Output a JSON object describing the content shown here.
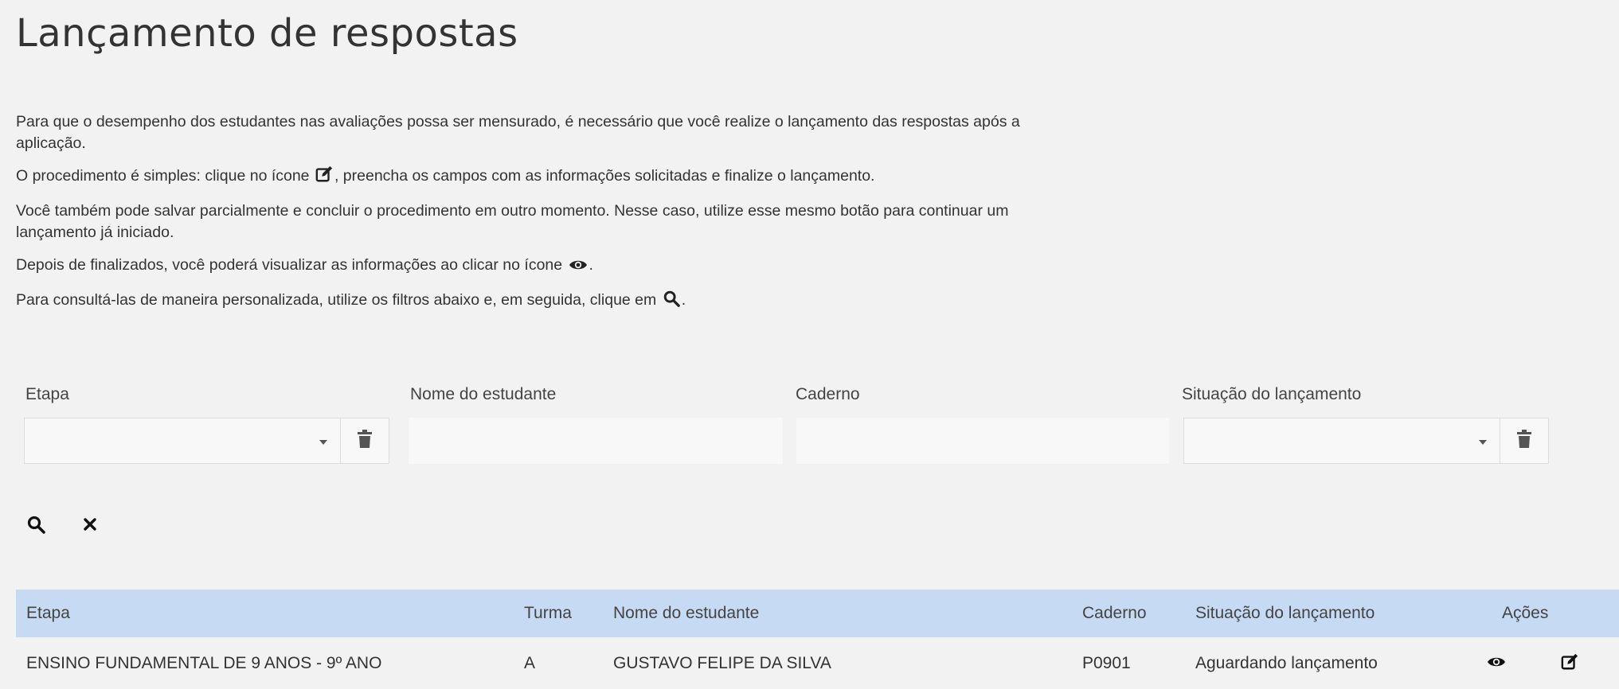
{
  "page": {
    "title": "Lançamento de respostas"
  },
  "intro": {
    "p1": "Para que o desempenho dos estudantes nas avaliações possa ser mensurado, é necessário que você realize o lançamento das respostas após a aplicação.",
    "p2_before": "O procedimento é simples: clique no ícone ",
    "p2_after": ", preencha os campos com as informações solicitadas e finalize o lançamento.",
    "p3": "Você também pode salvar parcialmente e concluir o procedimento em outro momento. Nesse caso, utilize esse mesmo botão para continuar um lançamento já iniciado.",
    "p4_before": "Depois de finalizados, você poderá visualizar as informações ao clicar no ícone ",
    "p4_after": ".",
    "p5_before": "Para consultá-las de maneira personalizada, utilize os filtros abaixo e, em seguida, clique em ",
    "p5_after": "."
  },
  "filters": {
    "etapa": {
      "label": "Etapa",
      "value": ""
    },
    "nome": {
      "label": "Nome do estudante",
      "value": "",
      "placeholder": ""
    },
    "caderno": {
      "label": "Caderno",
      "value": "",
      "placeholder": ""
    },
    "situacao": {
      "label": "Situação do lançamento",
      "value": ""
    }
  },
  "icons": {
    "edit": "edit-icon",
    "view": "eye-icon",
    "search": "search-icon",
    "clear": "close-icon",
    "trash": "trash-icon",
    "caret": "chevron-down-icon"
  },
  "colors": {
    "table_header_bg": "#c6daf3",
    "page_bg": "#f2f2f2"
  },
  "table": {
    "headers": {
      "etapa": "Etapa",
      "turma": "Turma",
      "nome": "Nome do estudante",
      "caderno": "Caderno",
      "situacao": "Situação do lançamento",
      "acoes": "Ações"
    },
    "rows": [
      {
        "etapa": "ENSINO FUNDAMENTAL DE 9 ANOS - 9º ANO",
        "turma": "A",
        "nome": "GUSTAVO FELIPE DA SILVA",
        "caderno": "P0901",
        "situacao": "Aguardando lançamento"
      }
    ]
  }
}
